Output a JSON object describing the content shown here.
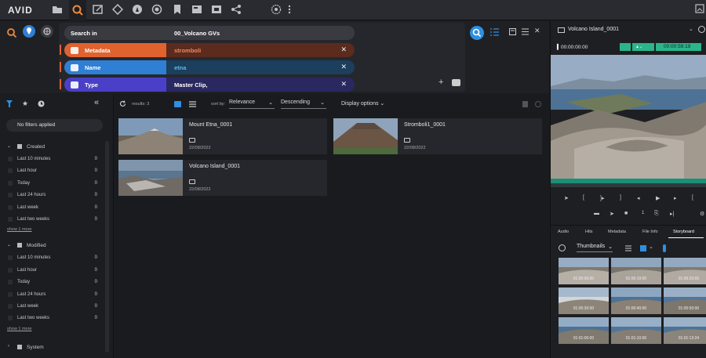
{
  "app": {
    "logo": "AVID"
  },
  "topbar": {
    "icons": [
      "folder-icon",
      "search-icon",
      "edit-icon",
      "diamond-icon",
      "rocket-icon",
      "circle-icon",
      "bookmark-icon",
      "news-icon",
      "film-icon",
      "share-icon",
      "globe-icon",
      "more-icon",
      "user-icon"
    ]
  },
  "search": {
    "location_label": "Search in",
    "location_value": "00_Volcano GVs",
    "criteria": [
      {
        "label": "Metadata",
        "value": "stromboli",
        "label_color": "#e0622f",
        "value_bg": "#5b2b1d",
        "value_color": "#f08a5d"
      },
      {
        "label": "Name",
        "value": "etna",
        "label_color": "#2f7fd4",
        "value_bg": "#1b3f5c",
        "value_color": "#5fb8ef"
      },
      {
        "label": "Type",
        "value": "Master Clip,",
        "label_color": "#4a40c8",
        "value_bg": "#2a2860",
        "value_color": "#ffffff"
      }
    ]
  },
  "filters": {
    "no_filters": "No filters applied",
    "groups": [
      {
        "title": "Created",
        "items": [
          {
            "label": "Last 10 minutes",
            "count": "0"
          },
          {
            "label": "Last hour",
            "count": "0"
          },
          {
            "label": "Today",
            "count": "0"
          },
          {
            "label": "Last 24 hours",
            "count": "0"
          },
          {
            "label": "Last week",
            "count": "0"
          },
          {
            "label": "Last two weeks",
            "count": "0"
          }
        ],
        "show_more": "show 1 more"
      },
      {
        "title": "Modified",
        "items": [
          {
            "label": "Last 10 minutes",
            "count": "0"
          },
          {
            "label": "Last hour",
            "count": "0"
          },
          {
            "label": "Today",
            "count": "0"
          },
          {
            "label": "Last 24 hours",
            "count": "0"
          },
          {
            "label": "Last week",
            "count": "0"
          },
          {
            "label": "Last two weeks",
            "count": "0"
          }
        ],
        "show_more": "show 1 more"
      }
    ],
    "system": "System"
  },
  "results": {
    "count_label": "results: 3",
    "sort_by_label": "sort by:",
    "sort_by_value": "Relevance",
    "order_value": "Descending",
    "display_options": "Display options",
    "items": [
      {
        "title": "Mount Etna_0001",
        "date": "22/08/2022"
      },
      {
        "title": "Stromboli1_0001",
        "date": "22/08/2022"
      },
      {
        "title": "Volcano Island_0001",
        "date": "22/08/2022"
      }
    ]
  },
  "player": {
    "clip_title": "Volcano Island_0001",
    "timecode_in": "00:00:00:00",
    "timecode_out": "00:00:59:19",
    "tabs": [
      "Audio",
      "Hits",
      "Metadata",
      "File Info",
      "Storyboard"
    ],
    "active_tab": "Storyboard",
    "storyboard_view": "Thumbnails",
    "storyboard_timecodes": [
      "01:00:00:00",
      "01:00:10:00",
      "01:00:20:00",
      "01:00:30:00",
      "01:00:40:00",
      "01:00:50:00",
      "01:01:00:00",
      "01:01:10:00",
      "01:01:13:24"
    ],
    "counter": "1"
  }
}
